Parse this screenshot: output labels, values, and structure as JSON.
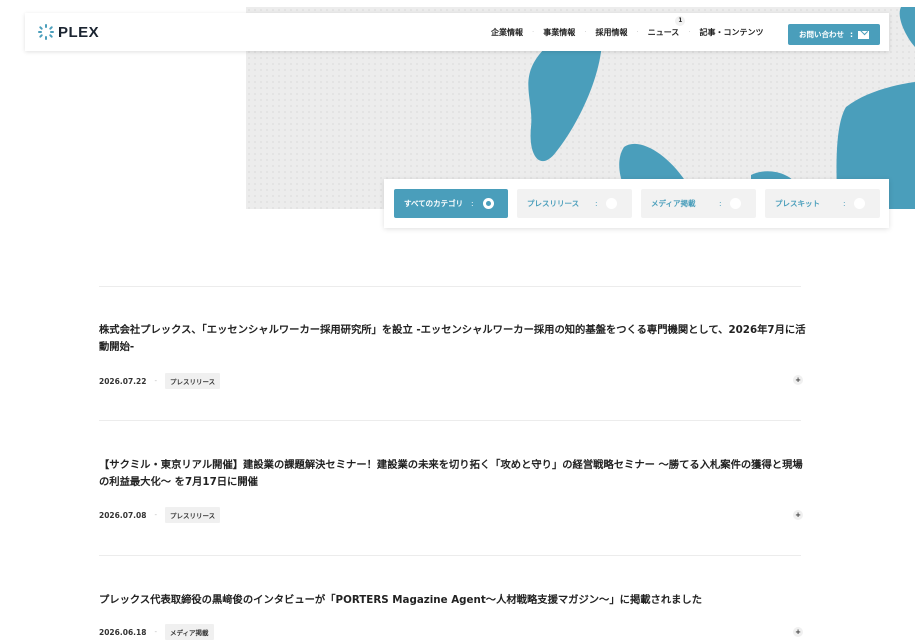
{
  "brand": {
    "name": "PLEX",
    "accent": "#4a9ebb"
  },
  "nav": {
    "items": [
      {
        "label": "企業情報"
      },
      {
        "label": "事業情報"
      },
      {
        "label": "採用情報"
      },
      {
        "label": "ニュース",
        "badge": "1"
      },
      {
        "label": "記事・コンテンツ"
      }
    ],
    "separator": "·",
    "contact_label": "お問い合わせ",
    "contact_colon": ":"
  },
  "filter": {
    "colon": ":",
    "categories": [
      {
        "label": "すべてのカテゴリ",
        "active": true
      },
      {
        "label": "プレスリリース",
        "active": false
      },
      {
        "label": "メディア掲載",
        "active": false
      },
      {
        "label": "プレスキット",
        "active": false
      }
    ]
  },
  "news": [
    {
      "title": "株式会社プレックス、「エッセンシャルワーカー採用研究所」を設立 -エッセンシャルワーカー採用の知的基盤をつくる専門機関として、2026年7月に活動開始-",
      "date": "2026.07.22",
      "tag": "プレスリリース",
      "more": "+"
    },
    {
      "title": "【サクミル・東京リアル開催】建設業の課題解決セミナー！建設業の未来を切り拓く「攻めと守り」の経営戦略セミナー ～勝てる入札案件の獲得と現場の利益最大化～ を7月17日に開催",
      "date": "2026.07.08",
      "tag": "プレスリリース",
      "more": "+"
    },
    {
      "title": "プレックス代表取締役の黒﨑俊のインタビューが「PORTERS Magazine Agent～人材戦略支援マガジン～」に掲載されました",
      "date": "2026.06.18",
      "tag": "メディア掲載",
      "more": "+"
    }
  ],
  "meta_separator": "-"
}
